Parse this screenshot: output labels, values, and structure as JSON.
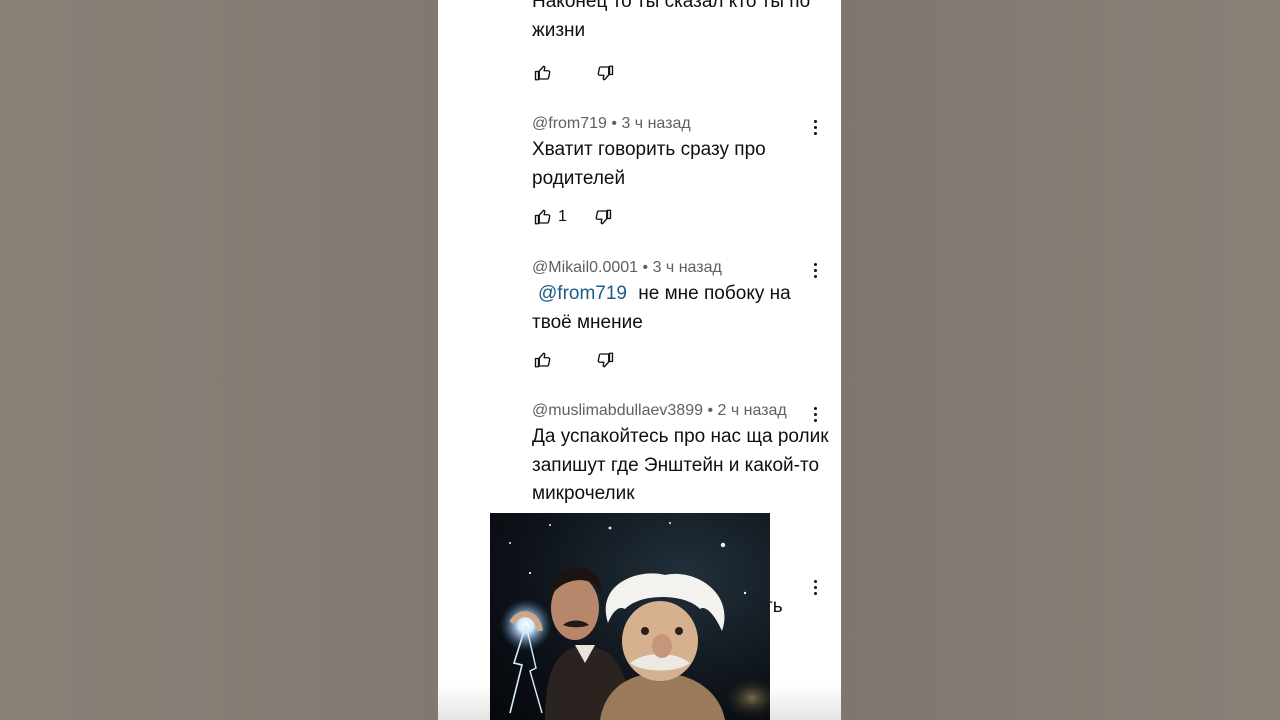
{
  "comments": [
    {
      "text": "Наконец то ты сказал кто ты по жизни"
    },
    {
      "author": "@from719",
      "time": "• 3 ч назад",
      "text": "Хватит говорить сразу про родителей",
      "likes": "1"
    },
    {
      "author": "@Mikail0.0001",
      "time": "• 3 ч назад",
      "mention": "@from719",
      "text": "не мне побоку на твоё мнение"
    },
    {
      "author": "@muslimabdullaev3899",
      "time": "• 2 ч назад",
      "text": "Да успакойтесь про нас ща ролик запишут где Энштейн и какой-то микрочелик"
    }
  ],
  "partial_text": "ть",
  "overlay_image": "tesla-einstein-caricature",
  "colors": {
    "page_bg": "#857d75",
    "panel_bg": "#ffffff",
    "mention": "#1a5c8a",
    "meta": "#606060"
  }
}
